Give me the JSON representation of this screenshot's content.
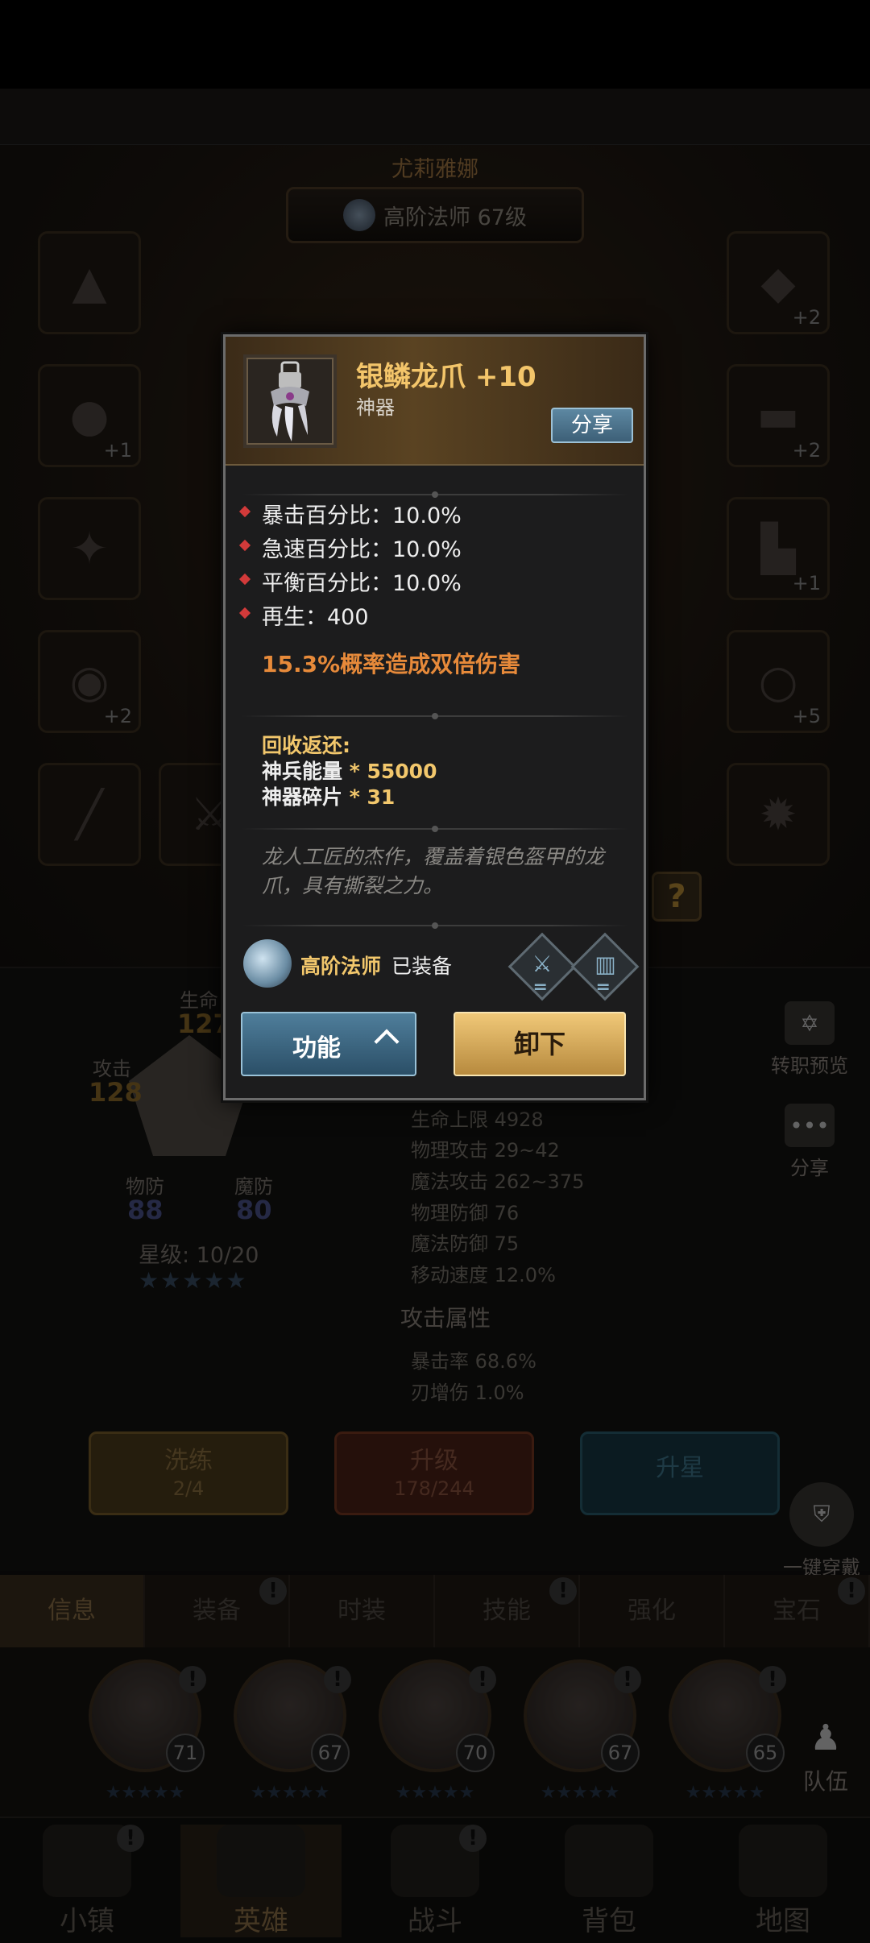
{
  "background": {
    "hero_name": "尤莉雅娜",
    "hero_class": "高阶法师 67级",
    "equip_slots_left": [
      {
        "icon": "hat-icon",
        "plus": ""
      },
      {
        "icon": "amulet-icon",
        "plus": "+1"
      },
      {
        "icon": "charm-icon",
        "plus": ""
      },
      {
        "icon": "drum-icon",
        "plus": "+2"
      },
      {
        "icon": "staff-icon",
        "plus": ""
      }
    ],
    "equip_slots_right": [
      {
        "icon": "armor-icon",
        "plus": "+2"
      },
      {
        "icon": "pants-icon",
        "plus": "+2"
      },
      {
        "icon": "boots-icon",
        "plus": "+1"
      },
      {
        "icon": "ring-icon",
        "plus": "+5"
      },
      {
        "icon": "orb-icon",
        "plus": ""
      }
    ],
    "help_label": "?",
    "radar": {
      "life_label": "生命",
      "life_value": "127",
      "attack_label": "攻击",
      "attack_value": "128",
      "pdef_label": "物防",
      "pdef_value": "88",
      "mdef_label": "魔防",
      "mdef_value": "80"
    },
    "star_level": "星级: 10/20",
    "stats": [
      "生命上限 4928",
      "物理攻击 29~42",
      "魔法攻击 262~375",
      "物理防御 76",
      "魔法防御 75",
      "移动速度 12.0%"
    ],
    "attack_section_title": "攻击属性",
    "attack_stats": [
      "暴击率 68.6%",
      "刃增伤 1.0%"
    ],
    "side_buttons": {
      "class_preview": "转职预览",
      "share": "分享",
      "one_click_equip": "一键穿戴"
    },
    "actions": {
      "refine_label": "洗练",
      "refine_count": "2/4",
      "upgrade_label": "升级",
      "upgrade_count": "178/244",
      "star_up_label": "升星"
    },
    "tabs": [
      "信息",
      "装备",
      "时装",
      "技能",
      "强化",
      "宝石"
    ],
    "team_label": "队伍",
    "heroes": [
      {
        "level": "71"
      },
      {
        "level": "67"
      },
      {
        "level": "70"
      },
      {
        "level": "67"
      },
      {
        "level": "65"
      }
    ],
    "nav": [
      "小镇",
      "英雄",
      "战斗",
      "背包",
      "地图"
    ],
    "alert_mark": "!"
  },
  "popup": {
    "item_name": "银鳞龙爪 +10",
    "item_type": "神器",
    "item_icon": "dragon-claw-icon",
    "share_label": "分享",
    "attributes": [
      "暴击百分比：10.0%",
      "急速百分比：10.0%",
      "平衡百分比：10.0%",
      "再生：400"
    ],
    "special_effect": "15.3%概率造成双倍伤害",
    "recycle_title": "回收返还:",
    "recycle_items": [
      {
        "name": "神兵能量",
        "amount": " * 55000"
      },
      {
        "name": "神器碎片",
        "amount": " * 31"
      }
    ],
    "description": "龙人工匠的杰作，覆盖着银色盔甲的龙爪，具有撕裂之力。",
    "equipped_class": "高阶法师",
    "equipped_status": "已装备",
    "compare_sign": "=",
    "function_label": "功能",
    "unequip_label": "卸下"
  },
  "colors": {
    "gold": "#f2c76c",
    "special_orange": "#e78a3a",
    "bullet_red": "#d23a3a",
    "share_blue": "#4f7e9b"
  }
}
